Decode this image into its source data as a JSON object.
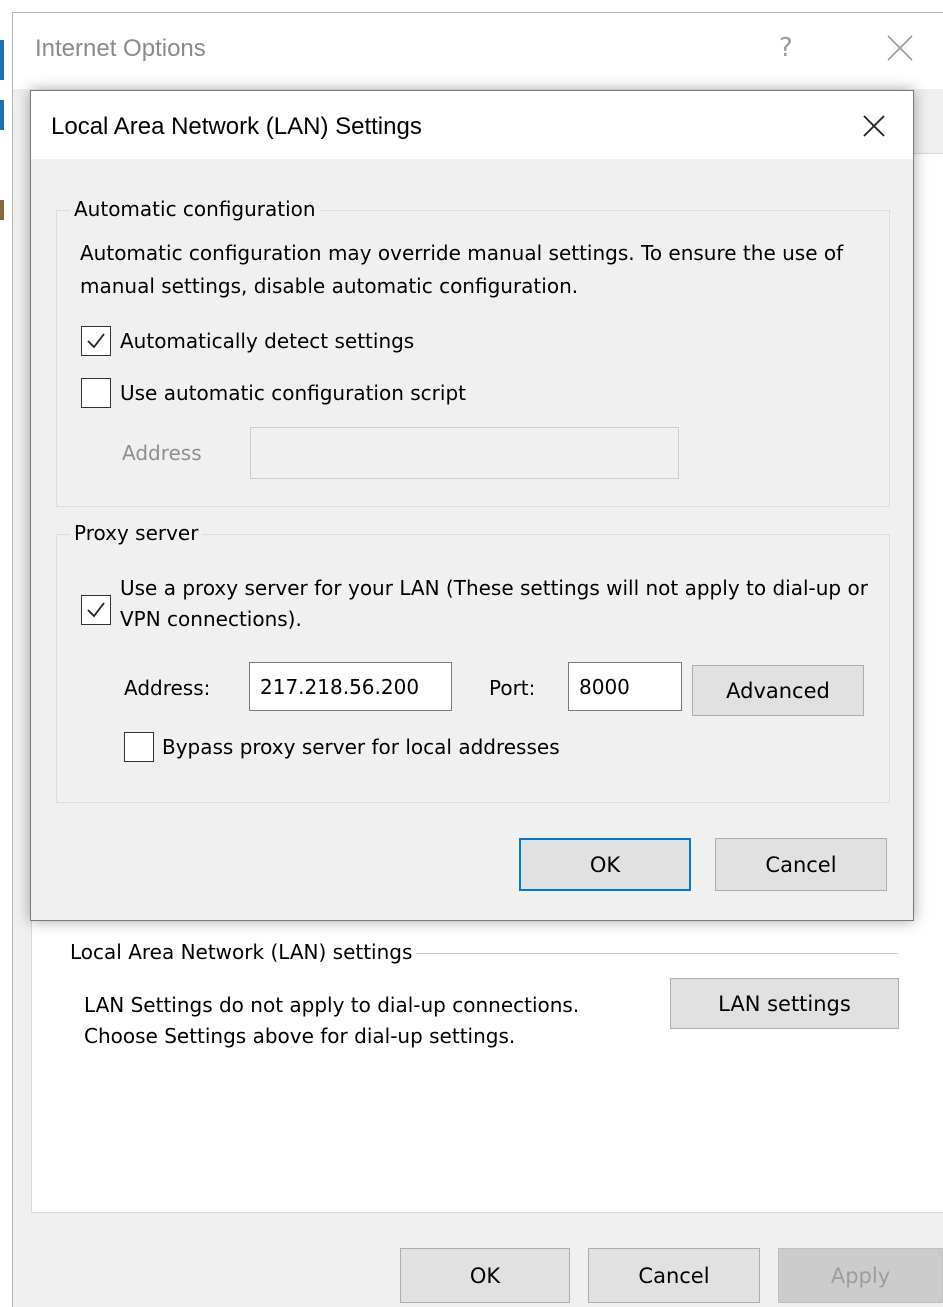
{
  "parent_window": {
    "title": "Internet Options",
    "help_glyph": "?",
    "lan_group": {
      "title": "Local Area Network (LAN) settings",
      "description": "LAN Settings do not apply to dial-up connections. Choose Settings above for dial-up settings.",
      "lan_settings_button": "LAN settings"
    },
    "buttons": {
      "ok": "OK",
      "cancel": "Cancel",
      "apply": "Apply"
    }
  },
  "dialog": {
    "title": "Local Area Network (LAN) Settings",
    "automatic_configuration": {
      "group_label": "Automatic configuration",
      "description": "Automatic configuration may override manual settings.  To ensure the use of manual settings, disable automatic configuration.",
      "auto_detect": {
        "label": "Automatically detect settings",
        "checked": true
      },
      "use_script": {
        "label": "Use automatic configuration script",
        "checked": false
      },
      "address_label": "Address",
      "address_value": ""
    },
    "proxy_server": {
      "group_label": "Proxy server",
      "use_proxy": {
        "label": "Use a proxy server for your LAN (These settings will not apply to dial-up or VPN connections).",
        "checked": true
      },
      "address_label": "Address:",
      "address_value": "217.218.56.200",
      "port_label": "Port:",
      "port_value": "8000",
      "advanced_button": "Advanced",
      "bypass_local": {
        "label": "Bypass proxy server for local addresses",
        "checked": false
      }
    },
    "ok_button": "OK",
    "cancel_button": "Cancel"
  },
  "colors": {
    "dialog_bg": "#f0f0f0",
    "focus_accent": "#0078d7",
    "button_bg": "#e1e1e1"
  }
}
